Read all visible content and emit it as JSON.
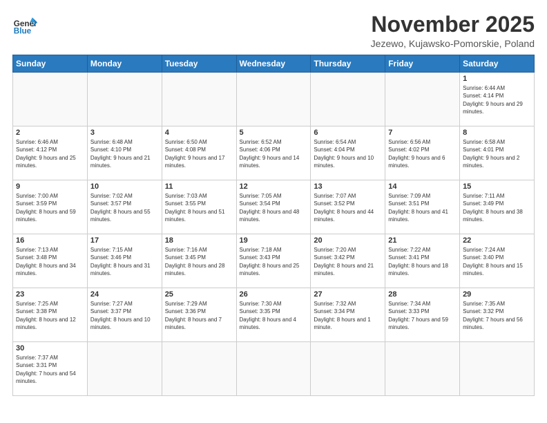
{
  "header": {
    "logo_general": "General",
    "logo_blue": "Blue",
    "month_title": "November 2025",
    "location": "Jezewo, Kujawsko-Pomorskie, Poland"
  },
  "weekdays": [
    "Sunday",
    "Monday",
    "Tuesday",
    "Wednesday",
    "Thursday",
    "Friday",
    "Saturday"
  ],
  "days": {
    "d1": {
      "num": "1",
      "sunrise": "6:44 AM",
      "sunset": "4:14 PM",
      "daylight": "9 hours and 29 minutes."
    },
    "d2": {
      "num": "2",
      "sunrise": "6:46 AM",
      "sunset": "4:12 PM",
      "daylight": "9 hours and 25 minutes."
    },
    "d3": {
      "num": "3",
      "sunrise": "6:48 AM",
      "sunset": "4:10 PM",
      "daylight": "9 hours and 21 minutes."
    },
    "d4": {
      "num": "4",
      "sunrise": "6:50 AM",
      "sunset": "4:08 PM",
      "daylight": "9 hours and 17 minutes."
    },
    "d5": {
      "num": "5",
      "sunrise": "6:52 AM",
      "sunset": "4:06 PM",
      "daylight": "9 hours and 14 minutes."
    },
    "d6": {
      "num": "6",
      "sunrise": "6:54 AM",
      "sunset": "4:04 PM",
      "daylight": "9 hours and 10 minutes."
    },
    "d7": {
      "num": "7",
      "sunrise": "6:56 AM",
      "sunset": "4:02 PM",
      "daylight": "9 hours and 6 minutes."
    },
    "d8": {
      "num": "8",
      "sunrise": "6:58 AM",
      "sunset": "4:01 PM",
      "daylight": "9 hours and 2 minutes."
    },
    "d9": {
      "num": "9",
      "sunrise": "7:00 AM",
      "sunset": "3:59 PM",
      "daylight": "8 hours and 59 minutes."
    },
    "d10": {
      "num": "10",
      "sunrise": "7:02 AM",
      "sunset": "3:57 PM",
      "daylight": "8 hours and 55 minutes."
    },
    "d11": {
      "num": "11",
      "sunrise": "7:03 AM",
      "sunset": "3:55 PM",
      "daylight": "8 hours and 51 minutes."
    },
    "d12": {
      "num": "12",
      "sunrise": "7:05 AM",
      "sunset": "3:54 PM",
      "daylight": "8 hours and 48 minutes."
    },
    "d13": {
      "num": "13",
      "sunrise": "7:07 AM",
      "sunset": "3:52 PM",
      "daylight": "8 hours and 44 minutes."
    },
    "d14": {
      "num": "14",
      "sunrise": "7:09 AM",
      "sunset": "3:51 PM",
      "daylight": "8 hours and 41 minutes."
    },
    "d15": {
      "num": "15",
      "sunrise": "7:11 AM",
      "sunset": "3:49 PM",
      "daylight": "8 hours and 38 minutes."
    },
    "d16": {
      "num": "16",
      "sunrise": "7:13 AM",
      "sunset": "3:48 PM",
      "daylight": "8 hours and 34 minutes."
    },
    "d17": {
      "num": "17",
      "sunrise": "7:15 AM",
      "sunset": "3:46 PM",
      "daylight": "8 hours and 31 minutes."
    },
    "d18": {
      "num": "18",
      "sunrise": "7:16 AM",
      "sunset": "3:45 PM",
      "daylight": "8 hours and 28 minutes."
    },
    "d19": {
      "num": "19",
      "sunrise": "7:18 AM",
      "sunset": "3:43 PM",
      "daylight": "8 hours and 25 minutes."
    },
    "d20": {
      "num": "20",
      "sunrise": "7:20 AM",
      "sunset": "3:42 PM",
      "daylight": "8 hours and 21 minutes."
    },
    "d21": {
      "num": "21",
      "sunrise": "7:22 AM",
      "sunset": "3:41 PM",
      "daylight": "8 hours and 18 minutes."
    },
    "d22": {
      "num": "22",
      "sunrise": "7:24 AM",
      "sunset": "3:40 PM",
      "daylight": "8 hours and 15 minutes."
    },
    "d23": {
      "num": "23",
      "sunrise": "7:25 AM",
      "sunset": "3:38 PM",
      "daylight": "8 hours and 12 minutes."
    },
    "d24": {
      "num": "24",
      "sunrise": "7:27 AM",
      "sunset": "3:37 PM",
      "daylight": "8 hours and 10 minutes."
    },
    "d25": {
      "num": "25",
      "sunrise": "7:29 AM",
      "sunset": "3:36 PM",
      "daylight": "8 hours and 7 minutes."
    },
    "d26": {
      "num": "26",
      "sunrise": "7:30 AM",
      "sunset": "3:35 PM",
      "daylight": "8 hours and 4 minutes."
    },
    "d27": {
      "num": "27",
      "sunrise": "7:32 AM",
      "sunset": "3:34 PM",
      "daylight": "8 hours and 1 minute."
    },
    "d28": {
      "num": "28",
      "sunrise": "7:34 AM",
      "sunset": "3:33 PM",
      "daylight": "7 hours and 59 minutes."
    },
    "d29": {
      "num": "29",
      "sunrise": "7:35 AM",
      "sunset": "3:32 PM",
      "daylight": "7 hours and 56 minutes."
    },
    "d30": {
      "num": "30",
      "sunrise": "7:37 AM",
      "sunset": "3:31 PM",
      "daylight": "7 hours and 54 minutes."
    }
  },
  "labels": {
    "sunrise": "Sunrise:",
    "sunset": "Sunset:",
    "daylight": "Daylight:"
  }
}
